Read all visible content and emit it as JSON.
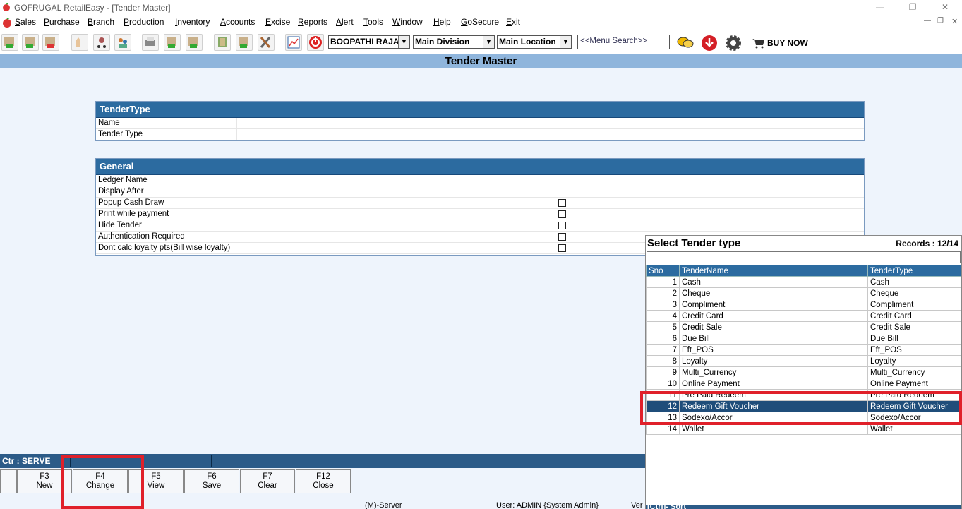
{
  "window": {
    "title": "GOFRUGAL RetailEasy - [Tender Master]"
  },
  "menu": [
    "Sales",
    "Purchase",
    "Branch",
    "Production",
    "Inventory",
    "Accounts",
    "Excise",
    "Reports",
    "Alert",
    "Tools",
    "Window",
    "Help",
    "GoSecure",
    "Exit"
  ],
  "toolbar": {
    "user_select": "BOOPATHI RAJA",
    "division_select": "Main Division",
    "location_select": "Main Location",
    "menu_search_placeholder": "<<Menu Search>>",
    "buy_now": "BUY NOW"
  },
  "header": {
    "title": "Tender Master"
  },
  "tender_type_panel": {
    "title": "TenderType",
    "fields": [
      "Name",
      "Tender Type"
    ]
  },
  "general_panel": {
    "title": "General",
    "fields": [
      "Ledger Name",
      "Display After",
      "Popup Cash Draw",
      "Print while payment",
      "Hide Tender",
      "Authentication Required",
      "Dont calc loyalty pts(Bill wise loyalty)"
    ]
  },
  "status": {
    "counter": "Ctr : SERVE"
  },
  "fkeys": [
    {
      "key": "F3",
      "label": "New"
    },
    {
      "key": "F4",
      "label": "Change"
    },
    {
      "key": "F5",
      "label": "View"
    },
    {
      "key": "F6",
      "label": "Save"
    },
    {
      "key": "F7",
      "label": "Clear"
    },
    {
      "key": "F12",
      "label": "Close"
    }
  ],
  "bottom": {
    "server": "(M)-Server",
    "user": "User: ADMIN {System Admin}",
    "version": "Ver",
    "ctrl_sort": "[Ctrl]- Sort"
  },
  "popup": {
    "title": "Select Tender type",
    "records": "Records : 12/14",
    "columns": [
      "Sno",
      "TenderName",
      "TenderType"
    ],
    "rows": [
      {
        "sno": "1",
        "name": "Cash",
        "type": "Cash"
      },
      {
        "sno": "2",
        "name": "Cheque",
        "type": "Cheque"
      },
      {
        "sno": "3",
        "name": "Compliment",
        "type": "Compliment"
      },
      {
        "sno": "4",
        "name": "Credit Card",
        "type": "Credit Card"
      },
      {
        "sno": "5",
        "name": "Credit Sale",
        "type": "Credit Sale"
      },
      {
        "sno": "6",
        "name": "Due Bill",
        "type": "Due Bill"
      },
      {
        "sno": "7",
        "name": "Eft_POS",
        "type": "Eft_POS"
      },
      {
        "sno": "8",
        "name": "Loyalty",
        "type": "Loyalty"
      },
      {
        "sno": "9",
        "name": "Multi_Currency",
        "type": "Multi_Currency"
      },
      {
        "sno": "10",
        "name": "Online Payment",
        "type": "Online Payment"
      },
      {
        "sno": "11",
        "name": "Pre Paid Redeem",
        "type": "Pre Paid Redeem"
      },
      {
        "sno": "12",
        "name": "Redeem Gift Voucher",
        "type": "Redeem Gift Voucher"
      },
      {
        "sno": "13",
        "name": "Sodexo/Accor",
        "type": "Sodexo/Accor"
      },
      {
        "sno": "14",
        "name": "Wallet",
        "type": "Wallet"
      }
    ],
    "selected_sno": "12"
  }
}
